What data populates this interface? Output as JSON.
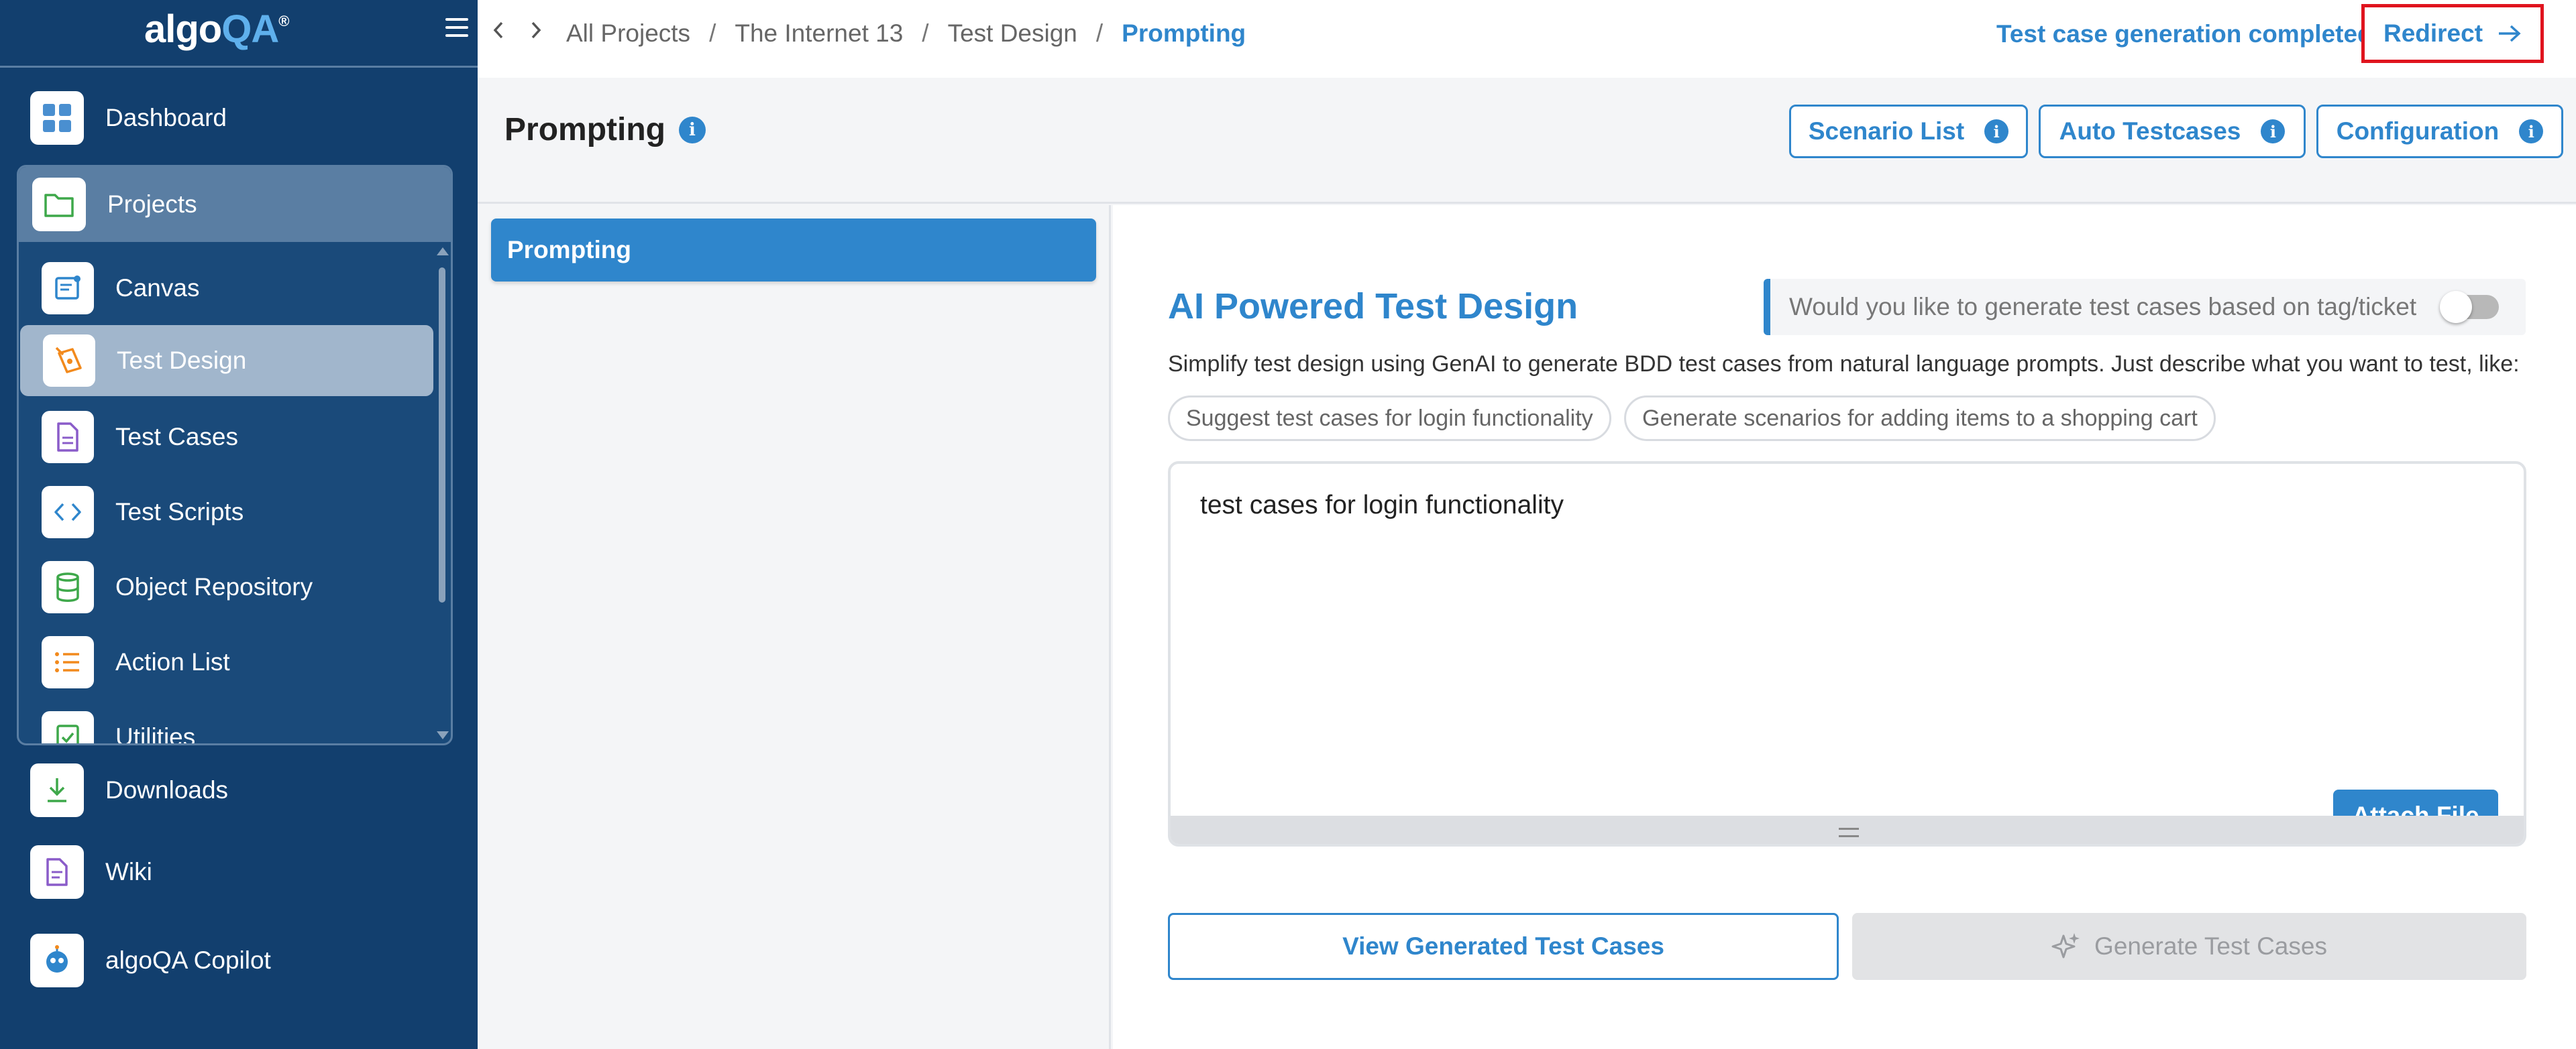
{
  "app": {
    "logo_main": "algo",
    "logo_accent": "QA",
    "logo_mark": "®"
  },
  "sidebar": {
    "dashboard": "Dashboard",
    "projects": "Projects",
    "sub_items": [
      "Canvas",
      "Test Design",
      "Test Cases",
      "Test Scripts",
      "Object Repository",
      "Action List",
      "Utilities"
    ],
    "downloads": "Downloads",
    "wiki": "Wiki",
    "copilot": "algoQA Copilot"
  },
  "breadcrumb": [
    "All Projects",
    "The Internet 13",
    "Test Design",
    "Prompting"
  ],
  "breadcrumb_sep": "/",
  "status": {
    "message": "Test case generation completed",
    "redirect_label": "Redirect"
  },
  "header": {
    "title": "Prompting",
    "buttons": [
      "Scenario List",
      "Auto Testcases",
      "Configuration"
    ]
  },
  "left_panel": {
    "tab": "Prompting"
  },
  "main": {
    "title": "AI Powered Test Design",
    "tag_toggle_label": "Would you like to generate test cases based on tag/ticket",
    "tag_toggle_on": false,
    "description": "Simplify test design using GenAI to generate BDD test cases from natural language prompts. Just describe what you want to test, like:",
    "suggestions": [
      "Suggest test cases for login functionality",
      "Generate scenarios for adding items to a shopping cart"
    ],
    "prompt_value": "test cases for login functionality",
    "attach_label": "Attach File",
    "view_label": "View Generated Test Cases",
    "generate_label": "Generate Test Cases"
  },
  "colors": {
    "sidebar": "#123f6e",
    "accent": "#2f86cc",
    "highlight": "#e0141e"
  }
}
